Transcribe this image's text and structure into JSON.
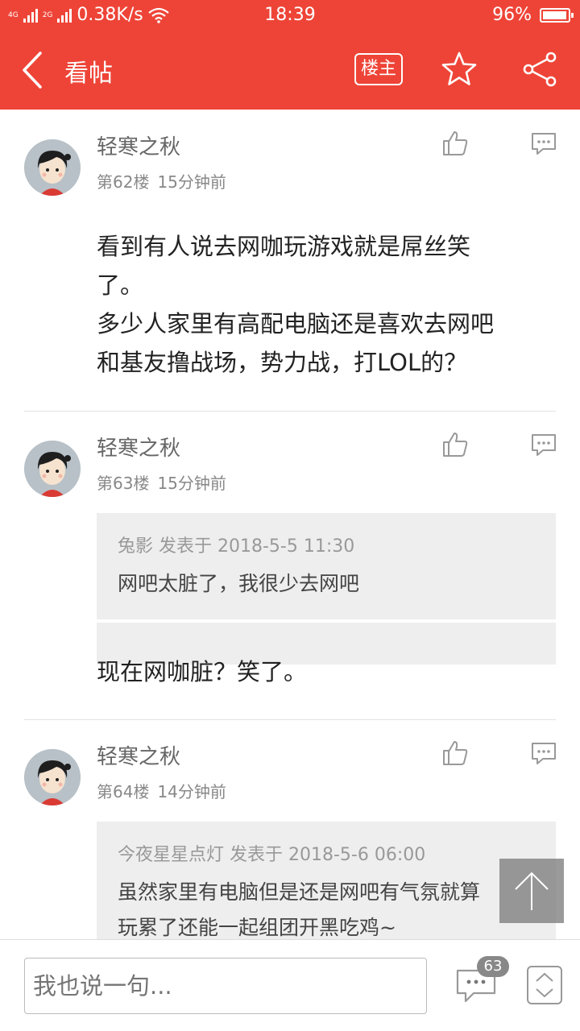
{
  "status_bar": {
    "network_left": "4G",
    "network_right": "2G",
    "speed": "0.38K/s",
    "time": "18:39",
    "battery": "96%"
  },
  "nav": {
    "title": "看帖",
    "owner_label": "楼主"
  },
  "posts": [
    {
      "user": "轻寒之秋",
      "floor": "第62楼",
      "time": "15分钟前",
      "lines": [
        "看到有人说去网咖玩游戏就是屌丝笑",
        "了。",
        "多少人家里有高配电脑还是喜欢去网吧",
        "和基友撸战场，势力战，打LOL的？"
      ]
    },
    {
      "user": "轻寒之秋",
      "floor": "第63楼",
      "time": "15分钟前",
      "quote": {
        "header": "兔影 发表于 2018-5-5 11:30",
        "text": [
          "网吧太脏了，我很少去网吧"
        ]
      },
      "lines": [
        "现在网咖脏？笑了。"
      ]
    },
    {
      "user": "轻寒之秋",
      "floor": "第64楼",
      "time": "14分钟前",
      "quote": {
        "header": "今夜星星点灯 发表于 2018-5-6 06:00",
        "text": [
          "虽然家里有电脑但是还是网吧有气氛就算",
          "玩累了还能一起组团开黑吃鸡~"
        ]
      }
    }
  ],
  "bottom": {
    "input_placeholder": "我也说一句...",
    "comment_count": "63"
  },
  "colors": {
    "brand": "#ee4437"
  },
  "icons": [
    "back-icon",
    "star-icon",
    "share-icon",
    "thumbs-up-icon",
    "comment-icon",
    "scroll-top-icon",
    "up-down-icon"
  ]
}
